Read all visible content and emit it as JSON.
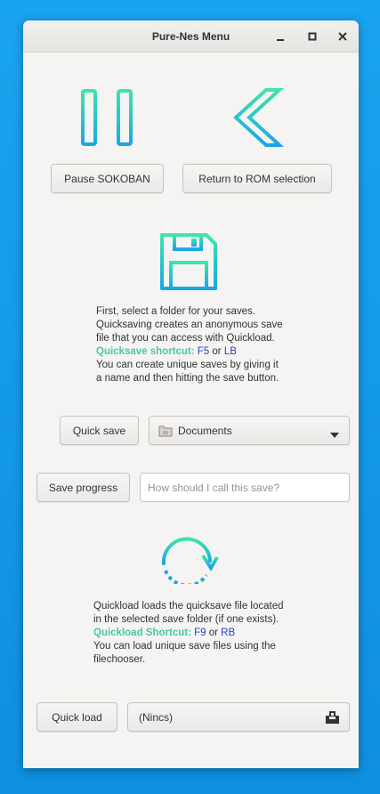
{
  "window": {
    "title": "Pure-Nes Menu"
  },
  "window_controls": {
    "minimize_icon": "minimize-icon",
    "maximize_icon": "maximize-icon",
    "close_icon": "close-icon"
  },
  "top": {
    "pause_label": "Pause SOKOBAN",
    "return_label": "Return to ROM selection"
  },
  "save_section": {
    "icon": "floppy-disk-icon",
    "line1": "First, select a folder for your saves.",
    "line2": "Quicksaving creates an anonymous save",
    "line3": "file that you can access with Quickload.",
    "shortcut_label": "Quicksave shortcut:",
    "shortcut_key1": "F5",
    "shortcut_or": "or",
    "shortcut_key2": "LB",
    "line5": "You can create unique saves by giving it",
    "line6": "a name and then hitting the save button.",
    "quick_save_label": "Quick save",
    "folder_value": "Documents",
    "save_progress_label": "Save progress",
    "name_placeholder": "How should I call this save?"
  },
  "load_section": {
    "icon": "reload-icon",
    "line1": "Quickload loads the quicksave file located",
    "line2": "in the selected save folder (if one exists).",
    "shortcut_label": "Quickload Shortcut:",
    "shortcut_key1": "F9",
    "shortcut_or": "or",
    "shortcut_key2": "RB",
    "line4": "You can load unique save files using the",
    "line5": "filechooser.",
    "quick_load_label": "Quick load",
    "file_value": "(Nincs)"
  },
  "colors": {
    "accent_gradient_start": "#3ee5a8",
    "accent_gradient_end": "#1aa6e6",
    "shortcut_label": "#46c8a6",
    "shortcut_key": "#2a3fc9"
  }
}
